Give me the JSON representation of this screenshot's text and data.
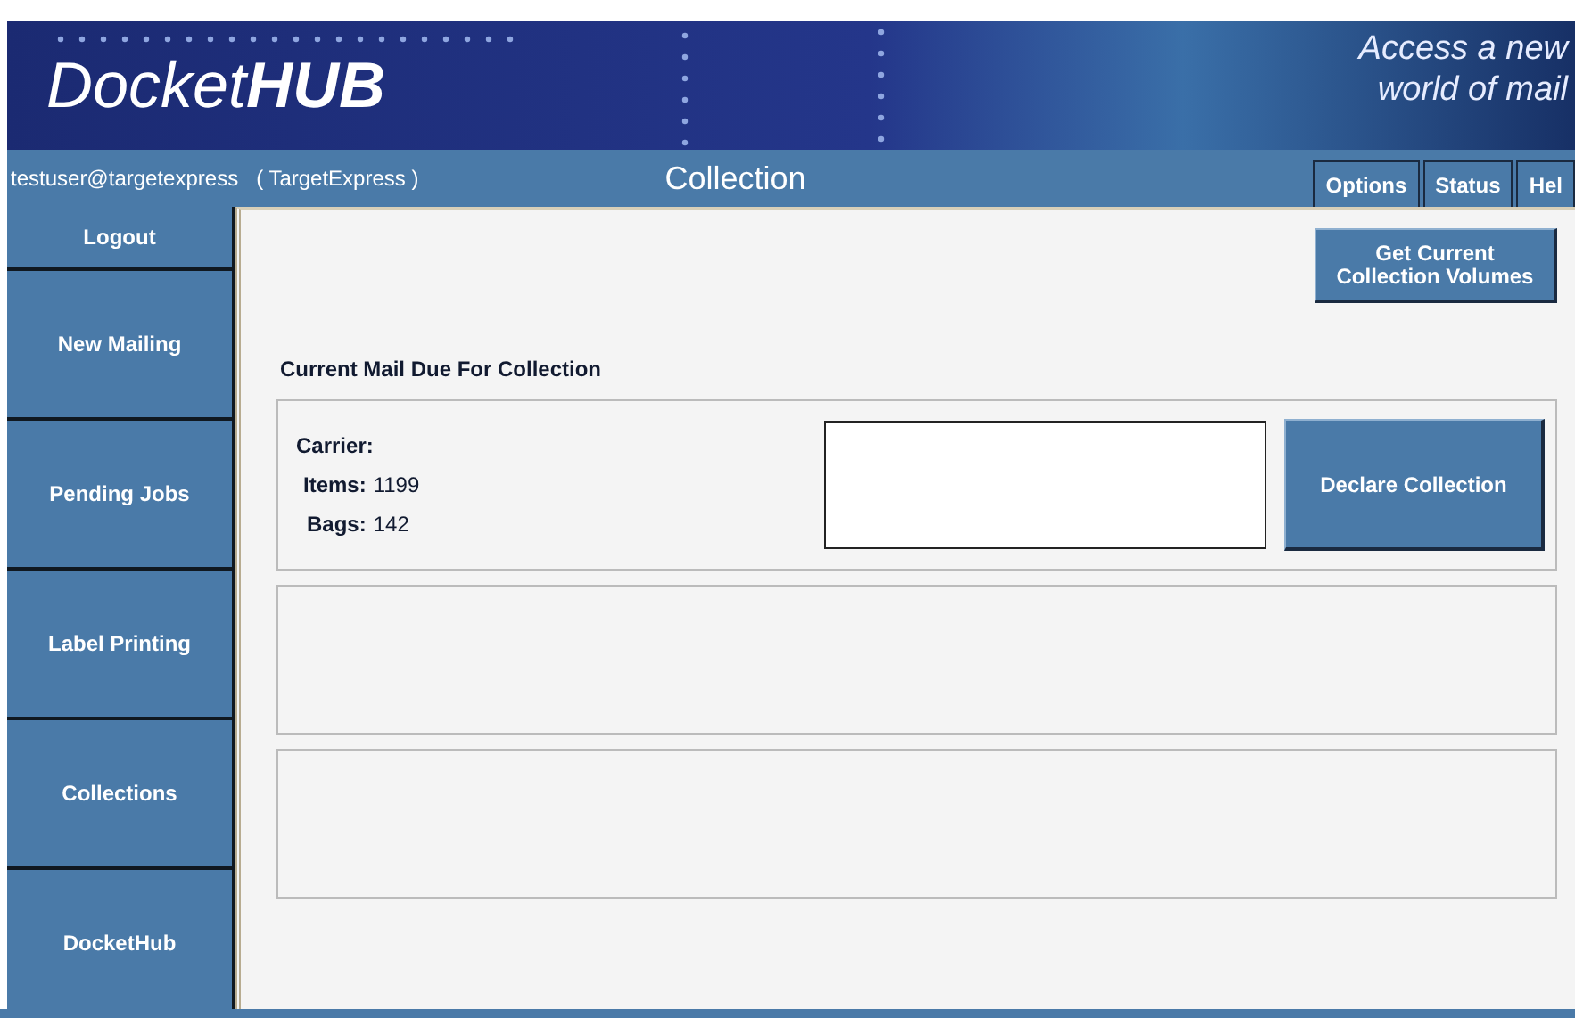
{
  "header": {
    "logo_regular": "Docket",
    "logo_bold": "HUB",
    "tagline_lines": [
      "Access a new",
      "world of mail"
    ]
  },
  "nav_bar": {
    "user": "testuser@targetexpress",
    "company": "( TargetExpress )",
    "page_title": "Collection",
    "buttons": [
      "Options",
      "Status",
      "Hel"
    ]
  },
  "sidebar": {
    "items": [
      "Logout",
      "New Mailing",
      "Pending Jobs",
      "Label Printing",
      "Collections",
      "DocketHub"
    ]
  },
  "main": {
    "refresh_button": "Get Current Collection Volumes",
    "section_title": "Current Mail Due For Collection",
    "details": [
      {
        "label": "Carrier:"
      },
      {
        "label": "Items:",
        "value": "1199"
      },
      {
        "label": "Bags:",
        "value": "142"
      }
    ],
    "declare_button": "Declare Collection"
  }
}
